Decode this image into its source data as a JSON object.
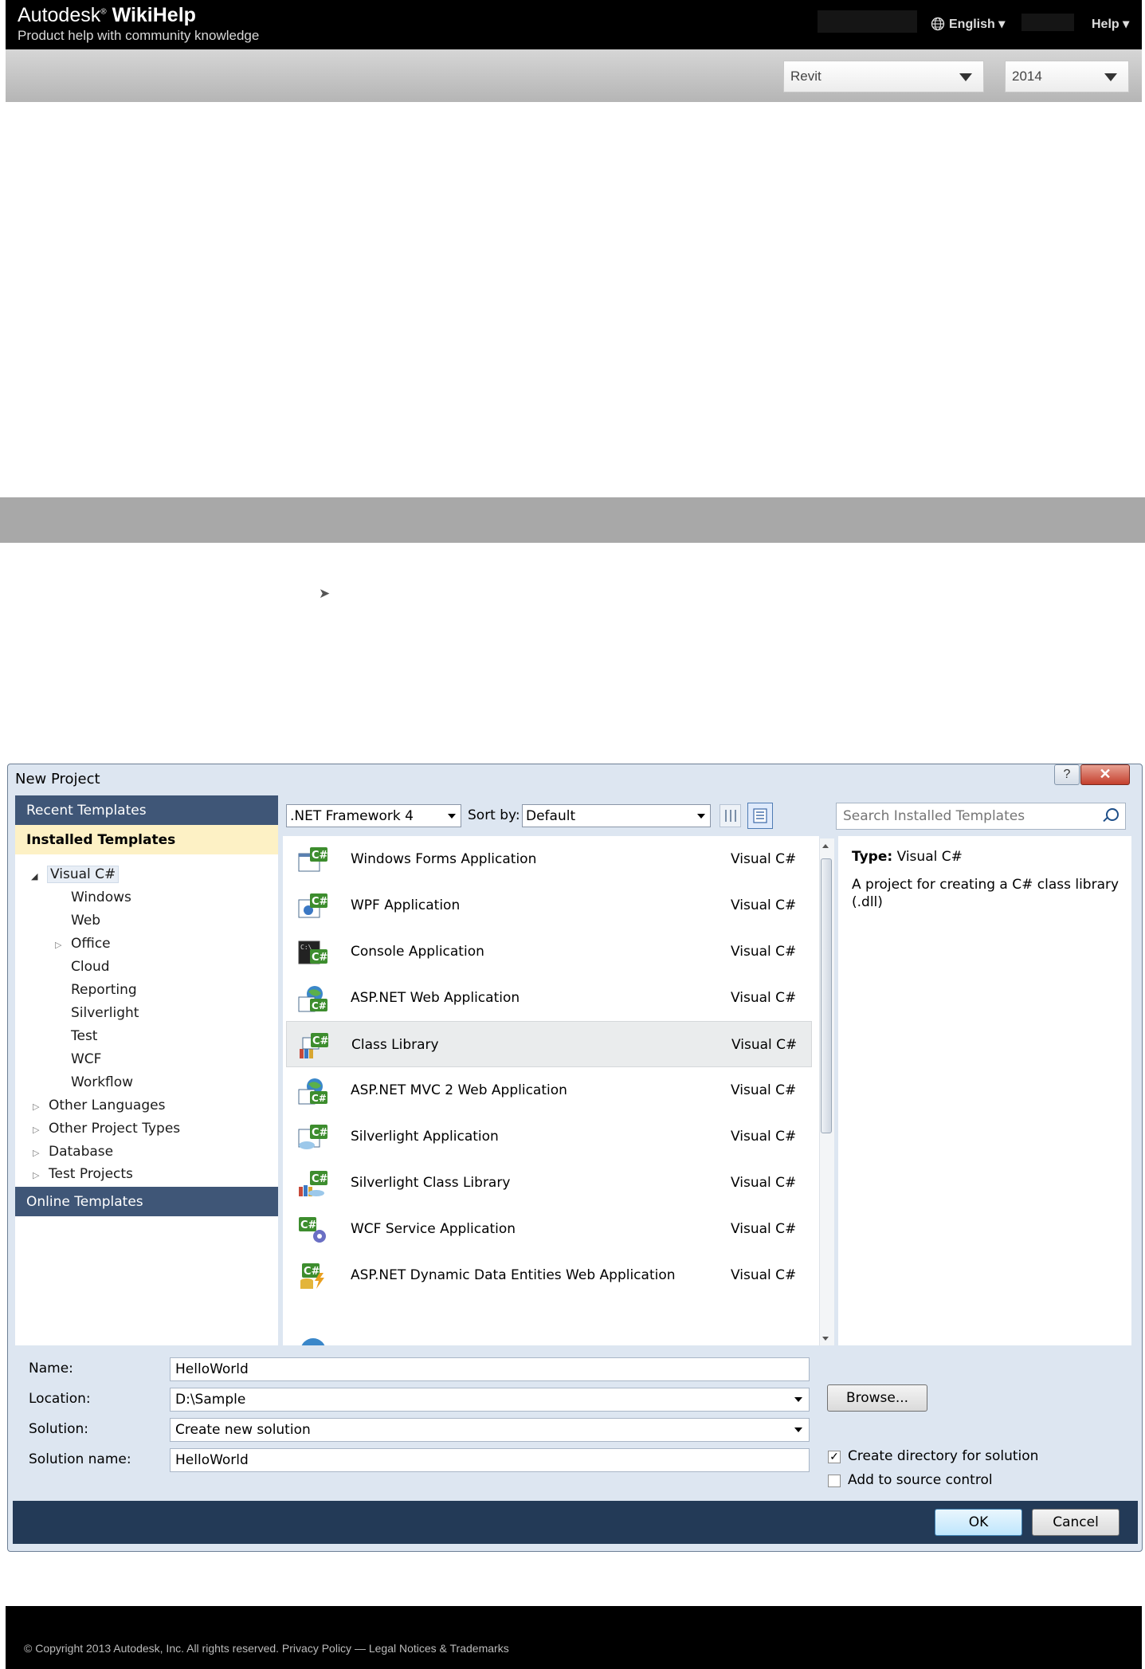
{
  "site": {
    "brand_name": "Autodesk",
    "brand_reg": "®",
    "brand_product": "WikiHelp",
    "tagline": "Product help with community knowledge",
    "language": "English ▾",
    "help": "Help ▾",
    "product_select": "Revit",
    "year_select": "2014",
    "breadcrumb_arrow": "➤",
    "footer_text": "© Copyright 2013 Autodesk, Inc. All rights reserved.   Privacy Policy — Legal Notices & Trademarks"
  },
  "dialog": {
    "title": "New Project",
    "help_button": "?",
    "close_button": "✕",
    "left": {
      "recent": "Recent Templates",
      "installed": "Installed Templates",
      "tree_root": "Visual C#",
      "tree_children": [
        "Windows",
        "Web",
        "Office",
        "Cloud",
        "Reporting",
        "Silverlight",
        "Test",
        "WCF",
        "Workflow"
      ],
      "tree_other": [
        "Other Languages",
        "Other Project Types",
        "Database",
        "Test Projects"
      ],
      "online": "Online Templates"
    },
    "toolbar": {
      "framework": ".NET Framework 4",
      "sort_label": "Sort by:",
      "sort_value": "Default",
      "search_placeholder": "Search Installed Templates"
    },
    "templates": [
      {
        "name": "Windows Forms Application",
        "lang": "Visual C#"
      },
      {
        "name": "WPF Application",
        "lang": "Visual C#"
      },
      {
        "name": "Console Application",
        "lang": "Visual C#"
      },
      {
        "name": "ASP.NET Web Application",
        "lang": "Visual C#"
      },
      {
        "name": "Class Library",
        "lang": "Visual C#"
      },
      {
        "name": "ASP.NET MVC 2 Web Application",
        "lang": "Visual C#"
      },
      {
        "name": "Silverlight Application",
        "lang": "Visual C#"
      },
      {
        "name": "Silverlight Class Library",
        "lang": "Visual C#"
      },
      {
        "name": "WCF Service Application",
        "lang": "Visual C#"
      },
      {
        "name": "ASP.NET Dynamic Data Entities Web Application",
        "lang": "Visual C#"
      }
    ],
    "info": {
      "type_label": "Type:",
      "type_value": "Visual C#",
      "description": "A project for creating a C# class library (.dll)"
    },
    "form": {
      "name_label": "Name:",
      "name_value": "HelloWorld",
      "location_label": "Location:",
      "location_value": "D:\\Sample",
      "solution_label": "Solution:",
      "solution_value": "Create new solution",
      "solution_name_label": "Solution name:",
      "solution_name_value": "HelloWorld",
      "browse": "Browse...",
      "create_dir": "Create directory for solution",
      "add_source": "Add to source control",
      "ok": "OK",
      "cancel": "Cancel"
    }
  }
}
